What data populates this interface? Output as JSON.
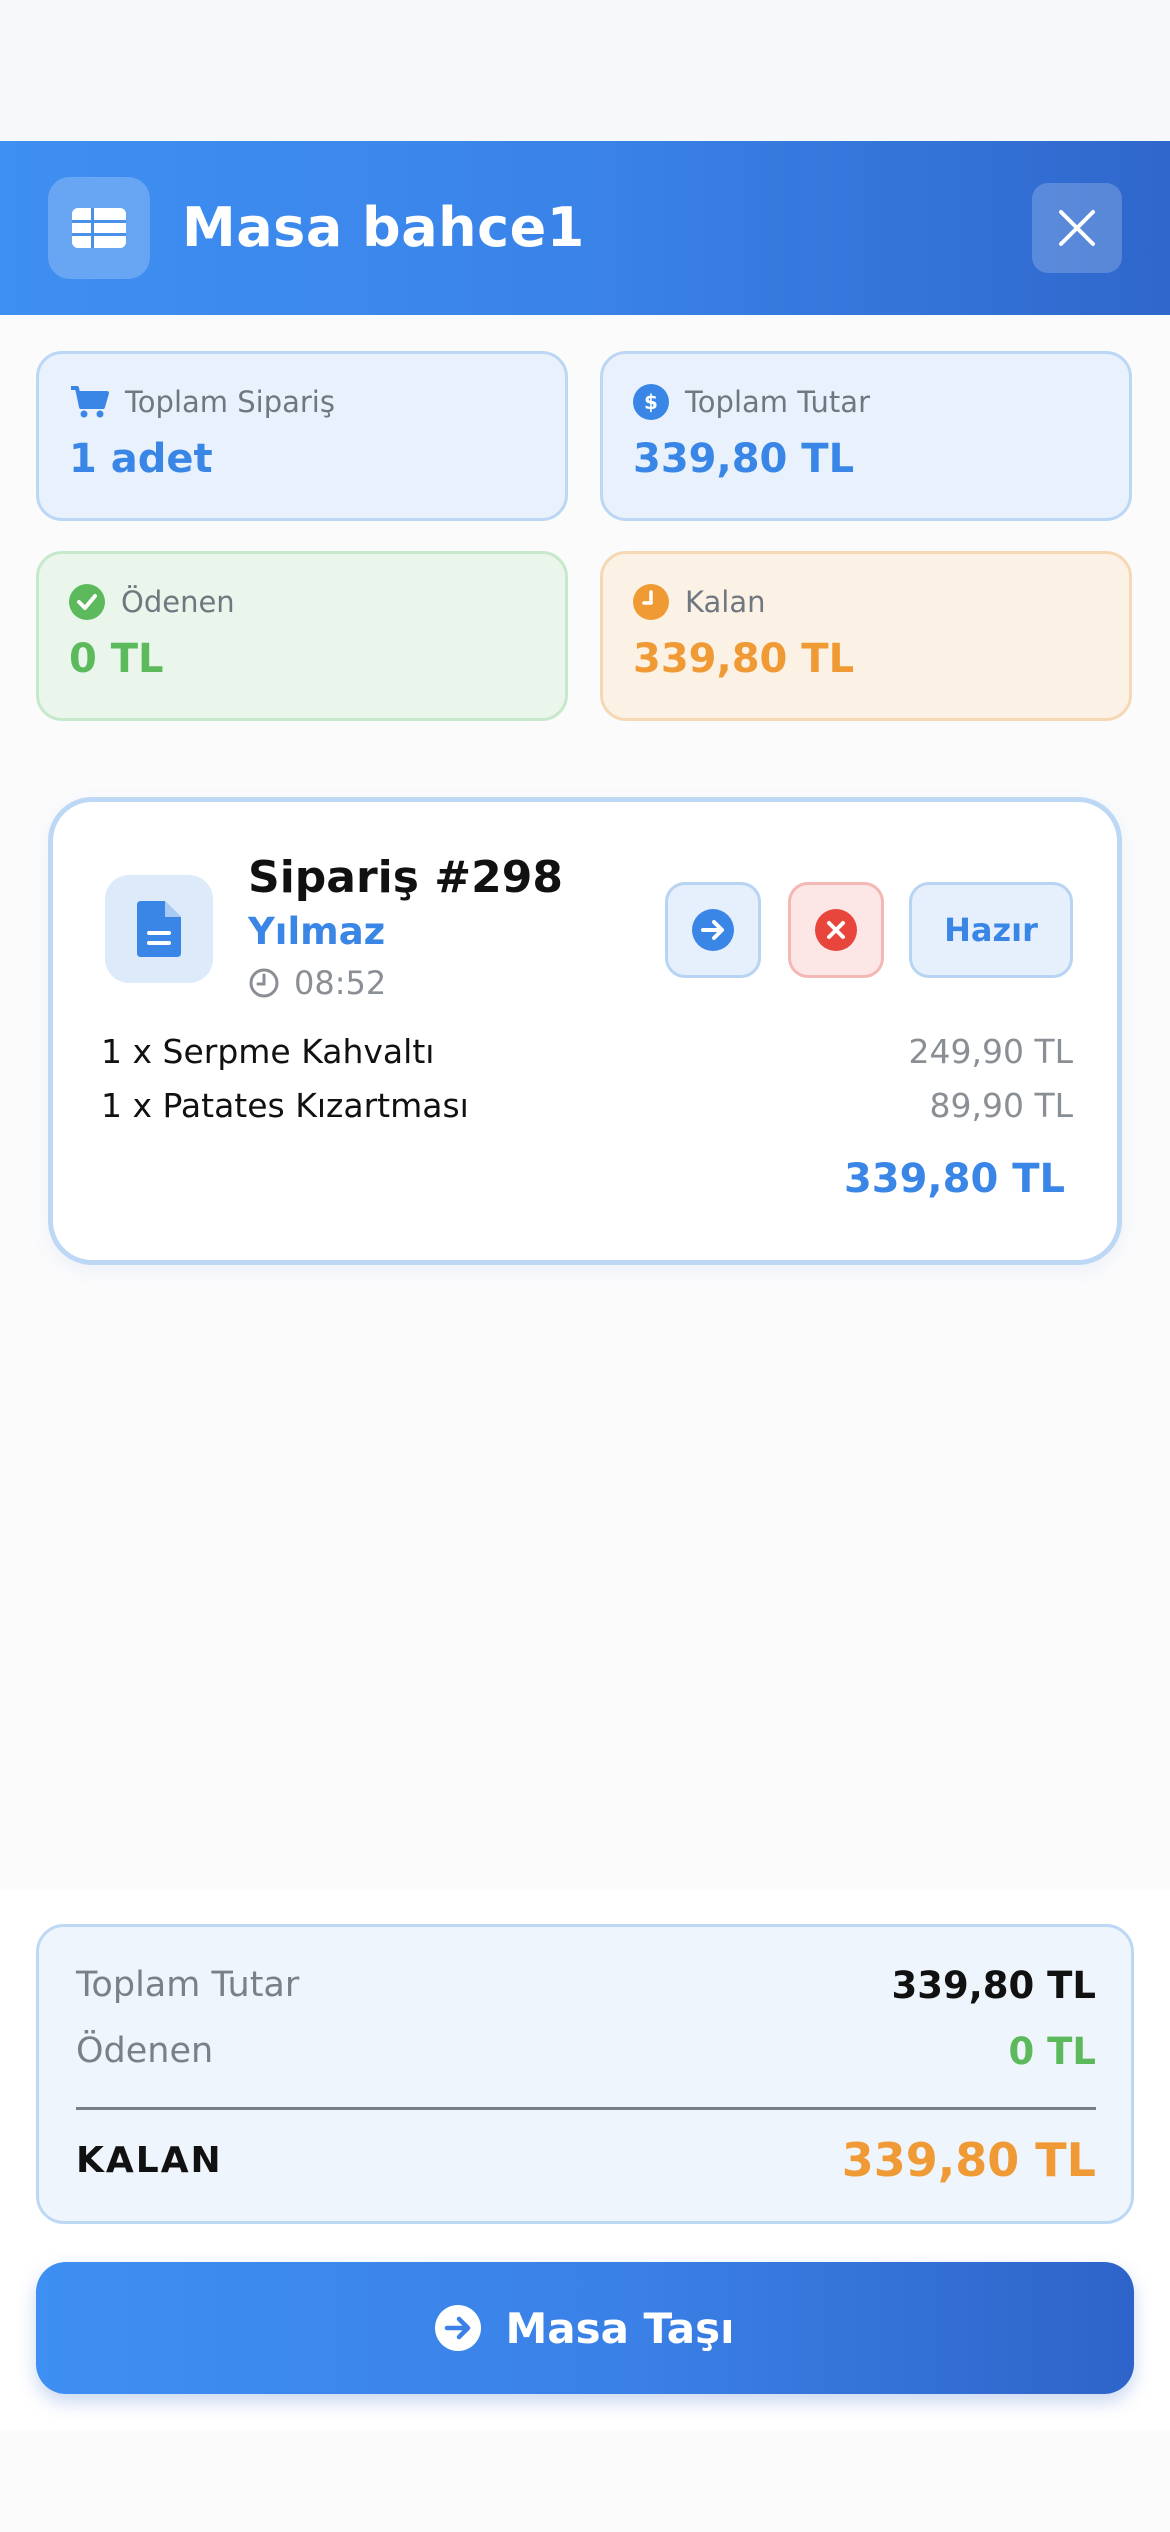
{
  "header": {
    "title": "Masa bahce1",
    "table_icon": "table-grid-icon",
    "close_icon": "close-icon"
  },
  "stats": [
    {
      "label": "Toplam Sipariş",
      "value": "1 adet",
      "icon": "cart-icon"
    },
    {
      "label": "Toplam Tutar",
      "value": "339,80 TL",
      "icon": "dollar-icon"
    },
    {
      "label": "Ödenen",
      "value": "0 TL",
      "icon": "check-circle-icon"
    },
    {
      "label": "Kalan",
      "value": "339,80 TL",
      "icon": "clock-icon"
    }
  ],
  "order": {
    "title": "Sipariş #298",
    "customer": "Yılmaz",
    "time": "08:52",
    "ready_label": "Hazır",
    "items": [
      {
        "name": "1 x Serpme Kahvaltı",
        "price": "249,90 TL"
      },
      {
        "name": "1 x Patates Kızartması",
        "price": "89,90 TL"
      }
    ],
    "total": "339,80 TL"
  },
  "summary": {
    "total_label": "Toplam Tutar",
    "total_value": "339,80 TL",
    "paid_label": "Ödenen",
    "paid_value": "0 TL",
    "remaining_label": "KALAN",
    "remaining_value": "339,80 TL"
  },
  "move_button": {
    "label": "Masa Taşı"
  },
  "colors": {
    "blue": "#3a86e6",
    "green": "#5cba5d",
    "orange": "#f09a35",
    "red": "#e8463c"
  }
}
